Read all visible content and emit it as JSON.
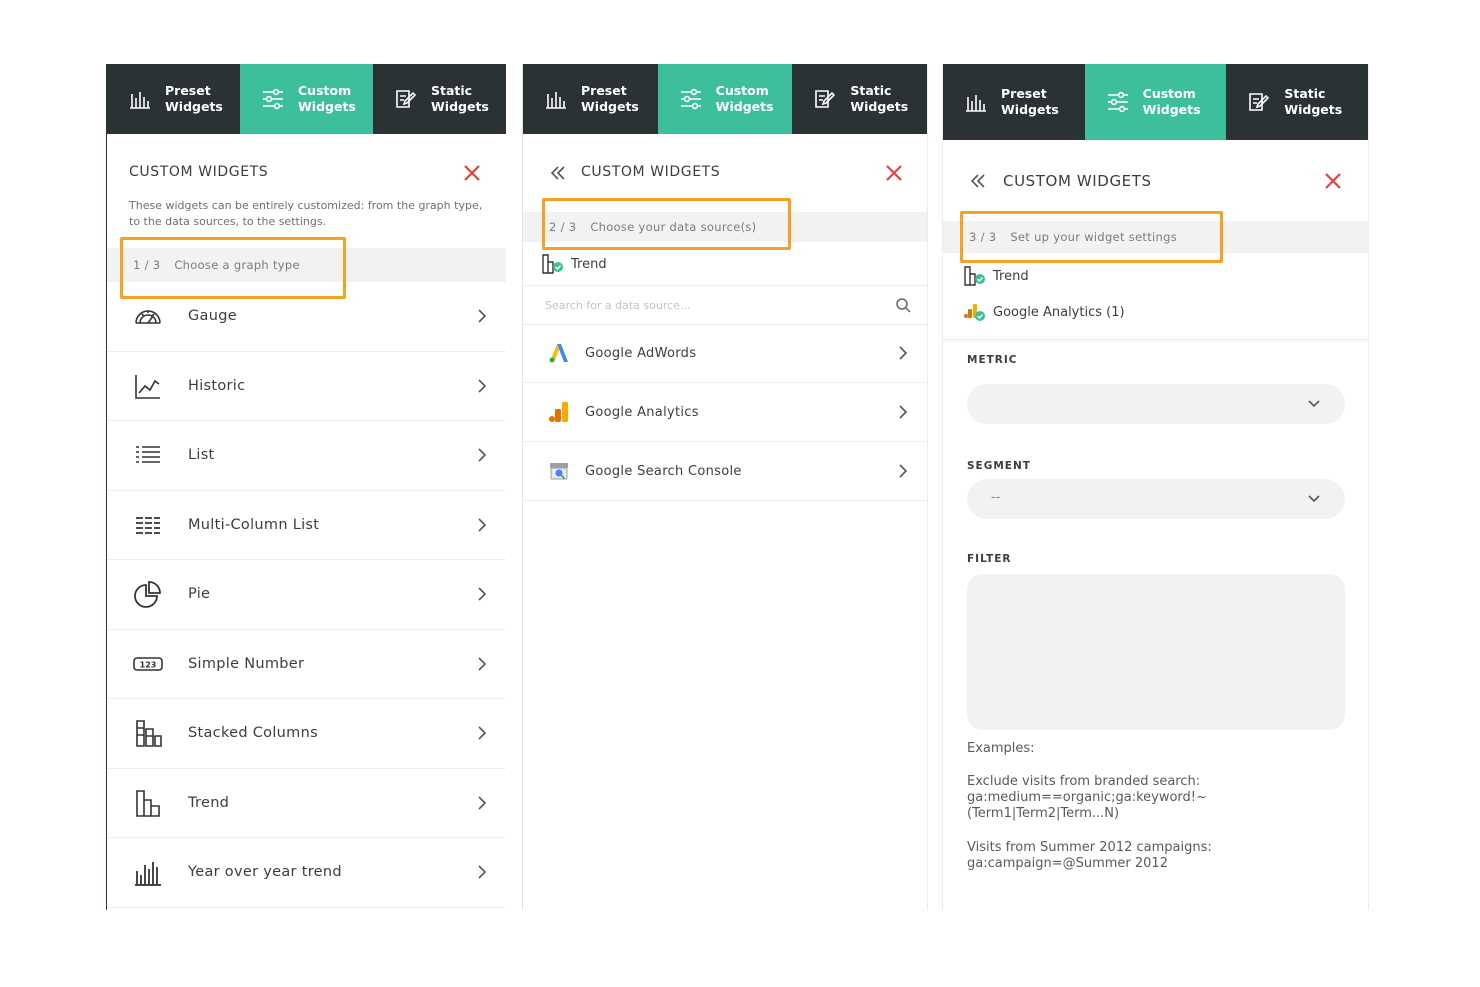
{
  "tabs": {
    "preset": "Preset Widgets",
    "custom": "Custom Widgets",
    "static": "Static Widgets"
  },
  "colors": {
    "tab_dark": "#2b3234",
    "tab_active": "#3dbf9e",
    "close_red": "#e8423c",
    "highlight": "#f4a224"
  },
  "panel1": {
    "title": "CUSTOM WIDGETS",
    "description": "These widgets can be entirely customized: from the graph type, to the data sources, to the settings.",
    "step_num": "1 / 3",
    "step_text": "Choose a graph type",
    "graph_types": [
      {
        "label": "Gauge",
        "icon": "gauge-icon"
      },
      {
        "label": "Historic",
        "icon": "historic-icon"
      },
      {
        "label": "List",
        "icon": "list-icon"
      },
      {
        "label": "Multi-Column List",
        "icon": "multi-column-list-icon"
      },
      {
        "label": "Pie",
        "icon": "pie-icon"
      },
      {
        "label": "Simple Number",
        "icon": "simple-number-icon"
      },
      {
        "label": "Stacked Columns",
        "icon": "stacked-columns-icon"
      },
      {
        "label": "Trend",
        "icon": "trend-icon"
      },
      {
        "label": "Year over year trend",
        "icon": "year-over-year-icon"
      }
    ],
    "simple_number_glyph": "123"
  },
  "panel2": {
    "title": "CUSTOM WIDGETS",
    "step_num": "2 / 3",
    "step_text": "Choose your data source(s)",
    "selected_graph": "Trend",
    "search_placeholder": "Search for a data source...",
    "sources": [
      {
        "label": "Google AdWords",
        "icon": "google-adwords-icon"
      },
      {
        "label": "Google Analytics",
        "icon": "google-analytics-icon"
      },
      {
        "label": "Google Search Console",
        "icon": "google-search-console-icon"
      }
    ]
  },
  "panel3": {
    "title": "CUSTOM WIDGETS",
    "step_num": "3 / 3",
    "step_text": "Set up your widget settings",
    "selected_graph": "Trend",
    "selected_source": "Google Analytics (1)",
    "metric_label": "METRIC",
    "metric_value": "",
    "segment_label": "SEGMENT",
    "segment_value": "--",
    "filter_label": "FILTER",
    "examples_heading": "Examples:",
    "example1_title": "Exclude visits from branded search:",
    "example1_code1": "ga:medium==organic;ga:keyword!~",
    "example1_code2": "(Term1|Term2|Term...N)",
    "example2_title": "Visits from Summer 2012 campaigns:",
    "example2_code": "ga:campaign=@Summer 2012"
  }
}
